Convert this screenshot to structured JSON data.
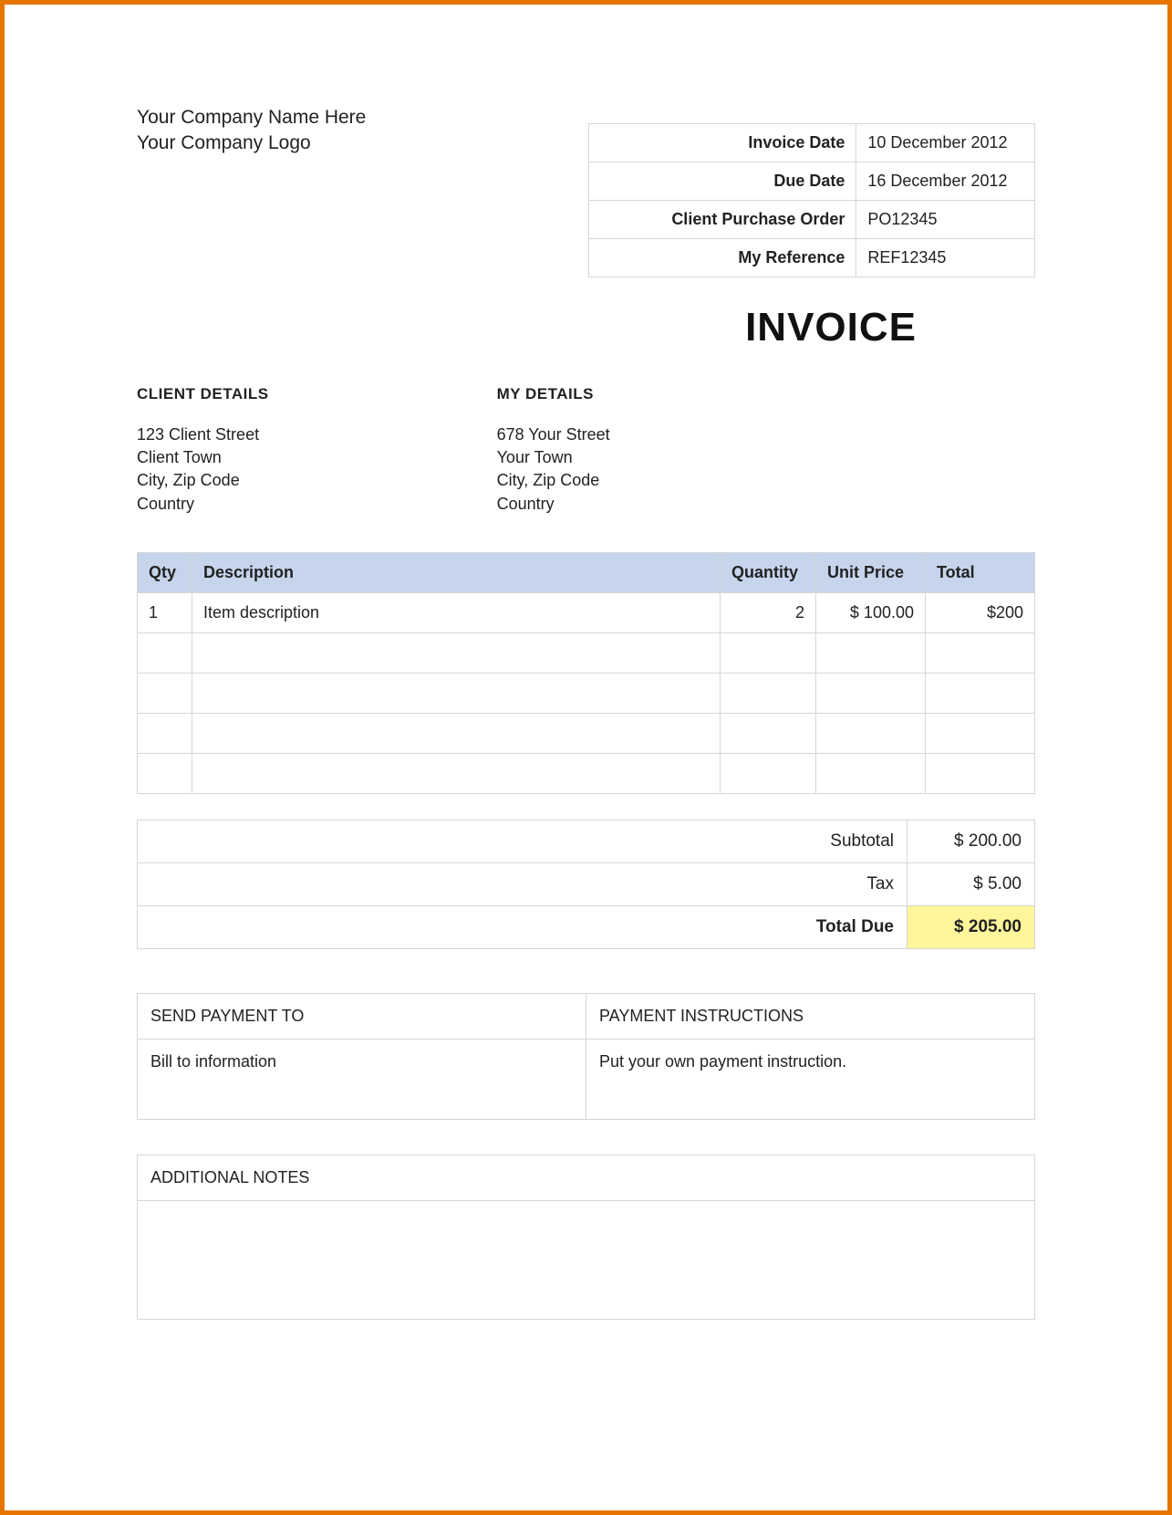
{
  "company": {
    "name": "Your Company Name Here",
    "logo": "Your Company Logo"
  },
  "meta": {
    "invoice_date_label": "Invoice Date",
    "invoice_date": "10 December  2012",
    "due_date_label": "Due Date",
    "due_date": "16 December  2012",
    "po_label": "Client Purchase Order",
    "po": "PO12345",
    "ref_label": "My Reference",
    "ref": "REF12345"
  },
  "title": "INVOICE",
  "client_details": {
    "heading": "CLIENT DETAILS",
    "line1": "123 Client Street",
    "line2": "Client Town",
    "line3": "City, Zip Code",
    "line4": "Country"
  },
  "my_details": {
    "heading": "MY DETAILS",
    "line1": "678 Your Street",
    "line2": "Your Town",
    "line3": "City, Zip Code",
    "line4": "Country"
  },
  "items": {
    "headers": {
      "qty": "Qty",
      "desc": "Description",
      "quantity": "Quantity",
      "unit": "Unit Price",
      "total": "Total"
    },
    "rows": [
      {
        "qty": "1",
        "desc": "Item description",
        "quantity": "2",
        "unit": "$ 100.00",
        "total": "$200"
      },
      {
        "qty": "",
        "desc": "",
        "quantity": "",
        "unit": "",
        "total": ""
      },
      {
        "qty": "",
        "desc": "",
        "quantity": "",
        "unit": "",
        "total": ""
      },
      {
        "qty": "",
        "desc": "",
        "quantity": "",
        "unit": "",
        "total": ""
      },
      {
        "qty": "",
        "desc": "",
        "quantity": "",
        "unit": "",
        "total": ""
      }
    ]
  },
  "totals": {
    "subtotal_label": "Subtotal",
    "subtotal": "$ 200.00",
    "tax_label": "Tax",
    "tax": "$ 5.00",
    "due_label": "Total Due",
    "due": "$ 205.00"
  },
  "payment": {
    "send_to_heading": "SEND PAYMENT TO",
    "instructions_heading": "PAYMENT INSTRUCTIONS",
    "send_to_body": "Bill to information",
    "instructions_body": "Put your own payment instruction."
  },
  "notes": {
    "heading": "ADDITIONAL NOTES",
    "body": ""
  }
}
